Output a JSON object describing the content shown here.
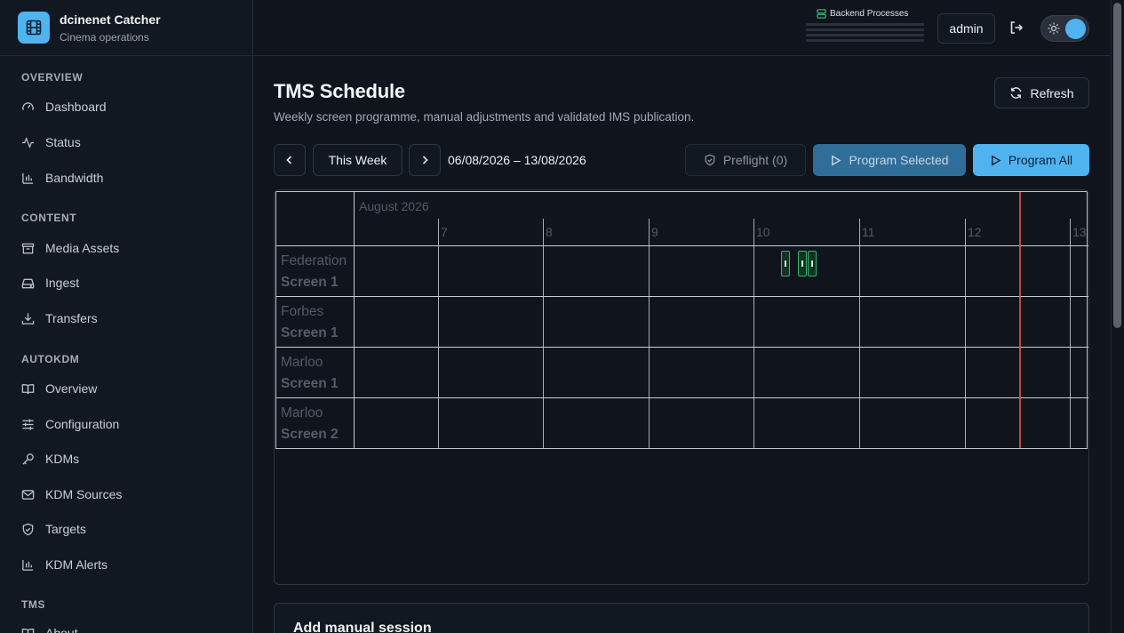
{
  "brand": {
    "title": "dcinenet Catcher",
    "subtitle": "Cinema operations",
    "icon": "film-icon",
    "accent": "#4fb3f0"
  },
  "sidebar": {
    "sections": [
      {
        "title": "OVERVIEW",
        "items": [
          {
            "label": "Dashboard",
            "icon": "gauge-icon"
          },
          {
            "label": "Status",
            "icon": "activity-icon"
          },
          {
            "label": "Bandwidth",
            "icon": "bar-chart-icon"
          }
        ]
      },
      {
        "title": "CONTENT",
        "items": [
          {
            "label": "Media Assets",
            "icon": "archive-icon"
          },
          {
            "label": "Ingest",
            "icon": "hard-drive-icon"
          },
          {
            "label": "Transfers",
            "icon": "download-icon"
          }
        ]
      },
      {
        "title": "AUTOKDM",
        "items": [
          {
            "label": "Overview",
            "icon": "book-icon"
          },
          {
            "label": "Configuration",
            "icon": "sliders-icon"
          },
          {
            "label": "KDMs",
            "icon": "key-icon"
          },
          {
            "label": "KDM Sources",
            "icon": "mail-icon"
          },
          {
            "label": "Targets",
            "icon": "shield-icon"
          },
          {
            "label": "KDM Alerts",
            "icon": "bar-chart-icon"
          }
        ]
      },
      {
        "title": "TMS",
        "items": [
          {
            "label": "About",
            "icon": "book-icon"
          }
        ]
      }
    ]
  },
  "topbar": {
    "backend_label": "Backend Processes",
    "user": "admin",
    "logout_icon": "logout-icon",
    "theme_icon": "sun-icon"
  },
  "page": {
    "title": "TMS Schedule",
    "subtitle": "Weekly screen programme, manual adjustments and validated IMS publication.",
    "refresh_label": "Refresh"
  },
  "toolbar": {
    "prev_icon": "chevron-left-icon",
    "this_week": "This Week",
    "next_icon": "chevron-right-icon",
    "date_range": "06/08/2026 – 13/08/2026",
    "preflight": "Preflight (0)",
    "program_selected": "Program Selected",
    "program_all": "Program All"
  },
  "calendar": {
    "month": "August 2026",
    "days": [
      "7",
      "8",
      "9",
      "10",
      "11",
      "12",
      "13"
    ],
    "resources": [
      {
        "site": "Federation",
        "screen": "Screen 1"
      },
      {
        "site": "Forbes",
        "screen": "Screen 1"
      },
      {
        "site": "Marloo",
        "screen": "Screen 1"
      },
      {
        "site": "Marloo",
        "screen": "Screen 2"
      }
    ],
    "event_color": "#37b36f",
    "now_color": "#d9534f"
  },
  "manual": {
    "title": "Add manual session"
  }
}
